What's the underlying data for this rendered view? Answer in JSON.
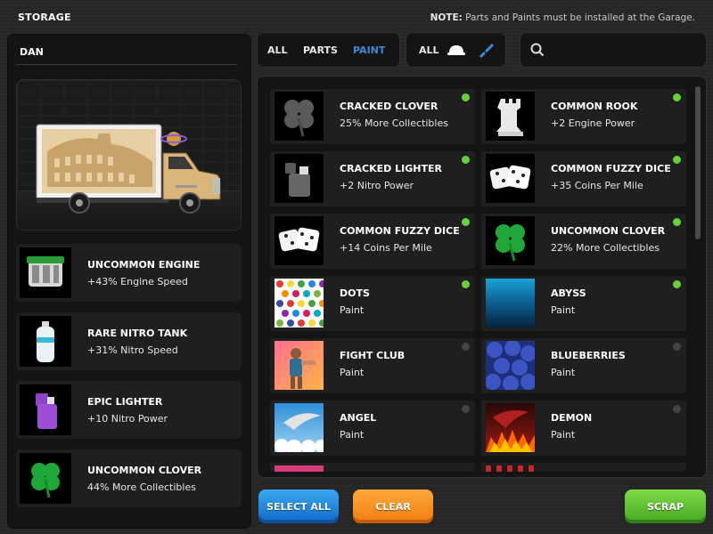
{
  "header": {
    "title": "STORAGE",
    "note_label": "NOTE:",
    "note_text": "Parts and Paints must be installed at the Garage."
  },
  "player": {
    "name": "DAN"
  },
  "equipped": [
    {
      "name": "UNCOMMON ENGINE",
      "desc": "+43% Engine Speed",
      "icon": "engine-icon"
    },
    {
      "name": "RARE NITRO TANK",
      "desc": "+31% Nitro Speed",
      "icon": "nitro-tank-icon"
    },
    {
      "name": "EPIC LIGHTER",
      "desc": "+10 Nitro Power",
      "icon": "lighter-icon"
    },
    {
      "name": "UNCOMMON CLOVER",
      "desc": "44% More Collectibles",
      "icon": "clover-icon"
    }
  ],
  "filters": {
    "tabs": [
      "ALL",
      "PARTS",
      "PAINT"
    ],
    "active_tab": "PAINT",
    "type_all": "ALL",
    "type_icons": [
      "hat-icon",
      "brush-icon"
    ]
  },
  "items": [
    {
      "name": "CRACKED CLOVER",
      "desc": "25% More Collectibles",
      "installed": true,
      "icon": "cracked-clover-icon"
    },
    {
      "name": "COMMON ROOK",
      "desc": "+2 Engine Power",
      "installed": true,
      "icon": "rook-icon"
    },
    {
      "name": "CRACKED LIGHTER",
      "desc": "+2 Nitro Power",
      "installed": true,
      "icon": "cracked-lighter-icon"
    },
    {
      "name": "COMMON FUZZY DICE",
      "desc": "+35 Coins Per Mile",
      "installed": true,
      "icon": "dice-icon"
    },
    {
      "name": "COMMON FUZZY DICE",
      "desc": "+14 Coins Per Mile",
      "installed": true,
      "icon": "dice-icon"
    },
    {
      "name": "UNCOMMON CLOVER",
      "desc": "22% More Collectibles",
      "installed": true,
      "icon": "clover-icon"
    },
    {
      "name": "DOTS",
      "desc": "Paint",
      "installed": true,
      "icon": "dots-paint-icon"
    },
    {
      "name": "ABYSS",
      "desc": "Paint",
      "installed": true,
      "icon": "abyss-paint-icon"
    },
    {
      "name": "FIGHT CLUB",
      "desc": "Paint",
      "installed": false,
      "icon": "fight-club-paint-icon"
    },
    {
      "name": "BLUEBERRIES",
      "desc": "Paint",
      "installed": false,
      "icon": "blueberries-paint-icon"
    },
    {
      "name": "ANGEL",
      "desc": "Paint",
      "installed": false,
      "icon": "angel-paint-icon"
    },
    {
      "name": "DEMON",
      "desc": "Paint",
      "installed": false,
      "icon": "demon-paint-icon"
    }
  ],
  "buttons": {
    "select_all": "SELECT ALL",
    "clear": "CLEAR",
    "scrap": "SCRAP"
  },
  "colors": {
    "active_tab": "#3d8bd9",
    "installed_dot": "#67d13c",
    "select_all": "#1f86df",
    "clear": "#f58a1b",
    "scrap": "#5bbd2e"
  }
}
